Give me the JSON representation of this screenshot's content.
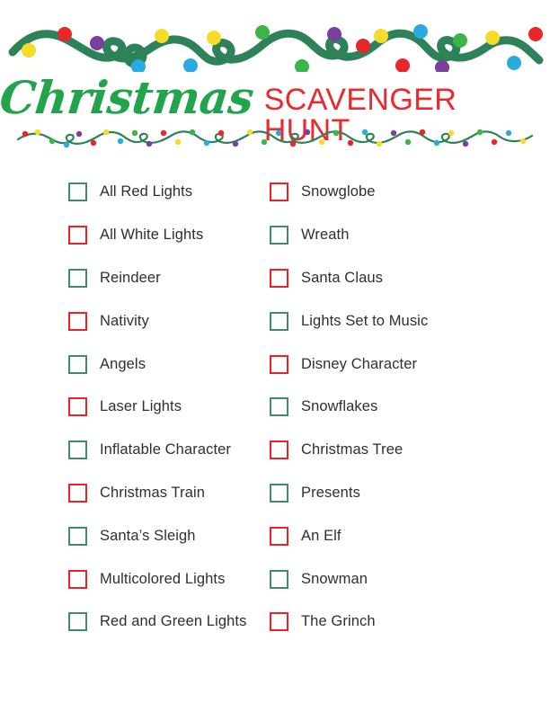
{
  "document": {
    "title_script": "Christmas",
    "title_block": "SCAVENGER HUNT"
  },
  "colors": {
    "script_green": "#23a34b",
    "title_red": "#ea2a2e",
    "checkbox_green": "#44896e",
    "checkbox_red": "#ec2227",
    "text": "#2f2f2f",
    "garland_cord": "#2e8259",
    "bulb_red": "#e8262c",
    "bulb_yellow": "#f5dc2a",
    "bulb_green": "#3cb44a",
    "bulb_blue": "#29abe2",
    "bulb_purple": "#7a3f9d",
    "background": "#ffffff"
  },
  "decorations": {
    "top_garland": "christmas-lights-garland",
    "divider": "christmas-string-lights"
  },
  "checklist": {
    "left_column": [
      {
        "label": "All Red Lights",
        "box_color": "green"
      },
      {
        "label": "All White Lights",
        "box_color": "red"
      },
      {
        "label": "Reindeer",
        "box_color": "green"
      },
      {
        "label": "Nativity",
        "box_color": "red"
      },
      {
        "label": "Angels",
        "box_color": "green"
      },
      {
        "label": "Laser Lights",
        "box_color": "red"
      },
      {
        "label": "Inflatable Character",
        "box_color": "green"
      },
      {
        "label": "Christmas Train",
        "box_color": "red"
      },
      {
        "label": "Santa’s Sleigh",
        "box_color": "green"
      },
      {
        "label": "Multicolored Lights",
        "box_color": "red"
      },
      {
        "label": "Red and Green Lights",
        "box_color": "green"
      }
    ],
    "right_column": [
      {
        "label": "Snowglobe",
        "box_color": "red"
      },
      {
        "label": "Wreath",
        "box_color": "green"
      },
      {
        "label": "Santa Claus",
        "box_color": "red"
      },
      {
        "label": "Lights Set to Music",
        "box_color": "green"
      },
      {
        "label": "Disney Character",
        "box_color": "red"
      },
      {
        "label": "Snowflakes",
        "box_color": "green"
      },
      {
        "label": "Christmas Tree",
        "box_color": "red"
      },
      {
        "label": "Presents",
        "box_color": "green"
      },
      {
        "label": "An Elf",
        "box_color": "red"
      },
      {
        "label": "Snowman",
        "box_color": "green"
      },
      {
        "label": "The Grinch",
        "box_color": "red"
      }
    ]
  }
}
